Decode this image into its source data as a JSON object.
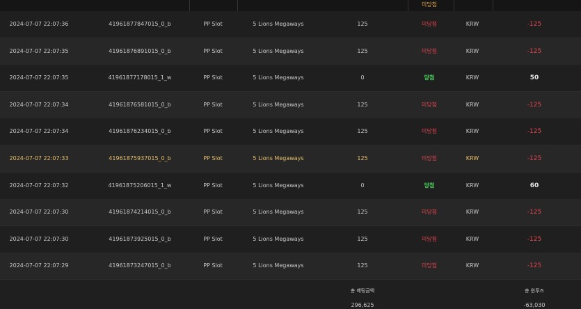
{
  "header": {
    "partial_labels": [
      "",
      "",
      "",
      "",
      "",
      "",
      "",
      ""
    ],
    "result_label": "미당첨"
  },
  "rows": [
    {
      "time": "2024-07-07 22:07:36",
      "round": "41961877847015_0_b",
      "provider": "PP Slot",
      "game": "5 Lions Megaways",
      "bet": "125",
      "result": "미당첨",
      "currency": "KRW",
      "win": "-125",
      "win_type": "neg",
      "highlight": false
    },
    {
      "time": "2024-07-07 22:07:35",
      "round": "41961876891015_0_b",
      "provider": "PP Slot",
      "game": "5 Lions Megaways",
      "bet": "125",
      "result": "미당첨",
      "currency": "KRW",
      "win": "-125",
      "win_type": "neg",
      "highlight": false
    },
    {
      "time": "2024-07-07 22:07:35",
      "round": "41961877178015_1_w",
      "provider": "PP Slot",
      "game": "5 Lions Megaways",
      "bet": "0",
      "result": "당첨",
      "currency": "KRW",
      "win": "50",
      "win_type": "pos",
      "highlight": false
    },
    {
      "time": "2024-07-07 22:07:34",
      "round": "41961876581015_0_b",
      "provider": "PP Slot",
      "game": "5 Lions Megaways",
      "bet": "125",
      "result": "미당첨",
      "currency": "KRW",
      "win": "-125",
      "win_type": "neg",
      "highlight": false
    },
    {
      "time": "2024-07-07 22:07:34",
      "round": "41961876234015_0_b",
      "provider": "PP Slot",
      "game": "5 Lions Megaways",
      "bet": "125",
      "result": "미당첨",
      "currency": "KRW",
      "win": "-125",
      "win_type": "neg",
      "highlight": false
    },
    {
      "time": "2024-07-07 22:07:33",
      "round": "41961875937015_0_b",
      "provider": "PP Slot",
      "game": "5 Lions Megaways",
      "bet": "125",
      "result": "미당첨",
      "currency": "KRW",
      "win": "-125",
      "win_type": "neg",
      "highlight": true
    },
    {
      "time": "2024-07-07 22:07:32",
      "round": "41961875206015_1_w",
      "provider": "PP Slot",
      "game": "5 Lions Megaways",
      "bet": "0",
      "result": "당첨",
      "currency": "KRW",
      "win": "60",
      "win_type": "pos",
      "highlight": false
    },
    {
      "time": "2024-07-07 22:07:30",
      "round": "41961874214015_0_b",
      "provider": "PP Slot",
      "game": "5 Lions Megaways",
      "bet": "125",
      "result": "미당첨",
      "currency": "KRW",
      "win": "-125",
      "win_type": "neg",
      "highlight": false
    },
    {
      "time": "2024-07-07 22:07:30",
      "round": "41961873925015_0_b",
      "provider": "PP Slot",
      "game": "5 Lions Megaways",
      "bet": "125",
      "result": "미당첨",
      "currency": "KRW",
      "win": "-125",
      "win_type": "neg",
      "highlight": false
    },
    {
      "time": "2024-07-07 22:07:29",
      "round": "41961873247015_0_b",
      "provider": "PP Slot",
      "game": "5 Lions Megaways",
      "bet": "125",
      "result": "미당첨",
      "currency": "KRW",
      "win": "-125",
      "win_type": "neg",
      "highlight": false
    }
  ],
  "footer": {
    "total_bet_label": "총 베팅금액",
    "total_bet_value": "296,625",
    "total_win_label": "총 윈루즈",
    "total_win_value": "-63,030"
  },
  "colors": {
    "lose": "#e0444f",
    "win": "#4cd35e",
    "highlight": "#e8c26e",
    "header": "#e0a94c"
  }
}
